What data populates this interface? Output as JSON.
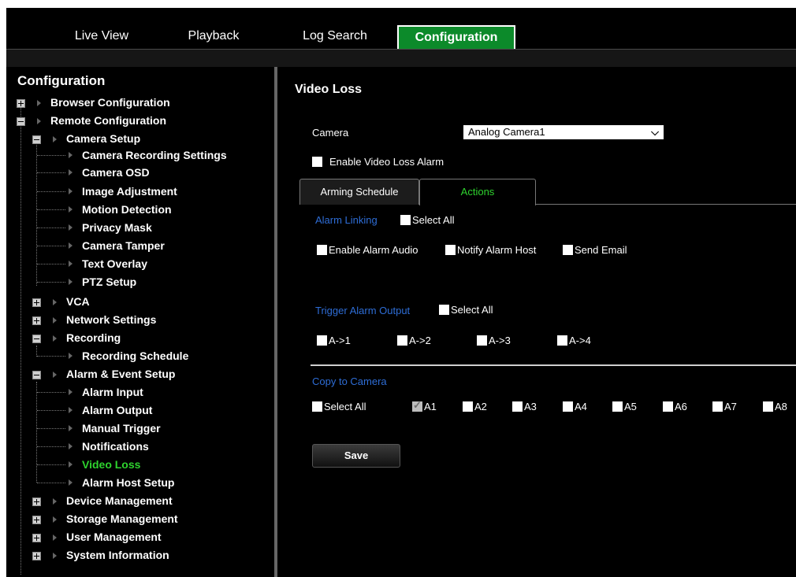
{
  "nav": {
    "tabs": [
      {
        "label": "Live View"
      },
      {
        "label": "Playback"
      },
      {
        "label": "Log Search"
      },
      {
        "label": "Configuration"
      }
    ]
  },
  "sidebar": {
    "title": "Configuration",
    "items": [
      {
        "label": "Browser Configuration"
      },
      {
        "label": "Remote Configuration"
      },
      {
        "label": "Camera Setup"
      },
      {
        "label": "Camera Recording Settings"
      },
      {
        "label": "Camera OSD"
      },
      {
        "label": "Image Adjustment"
      },
      {
        "label": "Motion Detection"
      },
      {
        "label": "Privacy Mask"
      },
      {
        "label": "Camera Tamper"
      },
      {
        "label": "Text Overlay"
      },
      {
        "label": "PTZ Setup"
      },
      {
        "label": "VCA"
      },
      {
        "label": "Network Settings"
      },
      {
        "label": "Recording"
      },
      {
        "label": "Recording Schedule"
      },
      {
        "label": "Alarm & Event Setup"
      },
      {
        "label": "Alarm Input"
      },
      {
        "label": "Alarm Output"
      },
      {
        "label": "Manual Trigger"
      },
      {
        "label": "Notifications"
      },
      {
        "label": "Video Loss"
      },
      {
        "label": "Alarm Host Setup"
      },
      {
        "label": "Device Management"
      },
      {
        "label": "Storage Management"
      },
      {
        "label": "User Management"
      },
      {
        "label": "System Information"
      }
    ]
  },
  "main": {
    "title": "Video Loss",
    "camera_label": "Camera",
    "camera_value": "Analog Camera1",
    "enable_label": "Enable Video Loss Alarm",
    "tabs": [
      {
        "label": "Arming Schedule"
      },
      {
        "label": "Actions"
      }
    ],
    "alarm_linking": {
      "heading": "Alarm Linking",
      "select_all": "Select All",
      "options": [
        "Enable Alarm Audio",
        "Notify Alarm Host",
        "Send Email"
      ]
    },
    "trigger_output": {
      "heading": "Trigger Alarm Output",
      "select_all": "Select All",
      "options": [
        "A->1",
        "A->2",
        "A->3",
        "A->4"
      ]
    },
    "copy_to_camera": {
      "heading": "Copy to Camera",
      "select_all": "Select All",
      "cameras": [
        "A1",
        "A2",
        "A3",
        "A4",
        "A5",
        "A6",
        "A7",
        "A8"
      ],
      "checked": [
        "A1"
      ]
    },
    "save_label": "Save"
  },
  "colors": {
    "active_tab": "#0c8a2a",
    "selected_text": "#2ed32e",
    "section_heading": "#2e6dd6"
  }
}
